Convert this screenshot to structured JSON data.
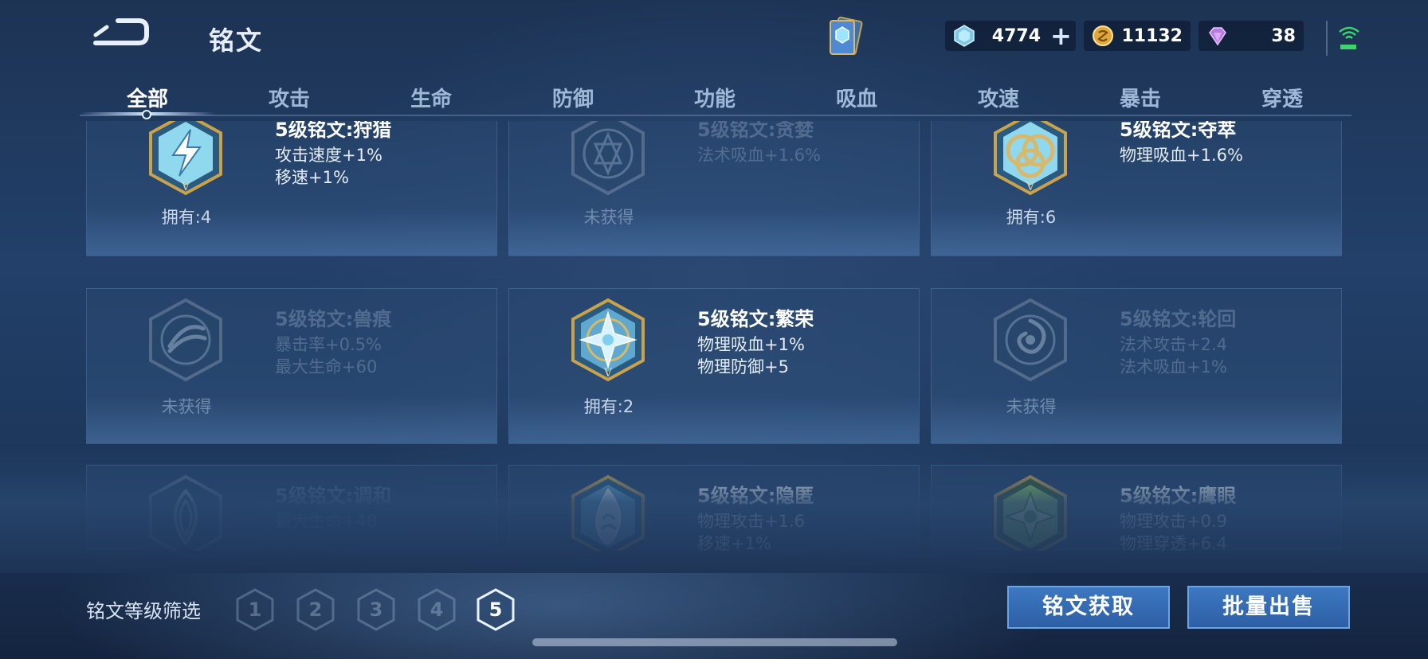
{
  "header": {
    "title": "铭文",
    "currencies": [
      {
        "icon": "crystal-icon",
        "value": "4774"
      },
      {
        "icon": "gold-coin-icon",
        "value": "11132"
      },
      {
        "icon": "diamond-icon",
        "value": "38"
      }
    ],
    "plus_label": "+"
  },
  "tabs": [
    "全部",
    "攻击",
    "生命",
    "防御",
    "功能",
    "吸血",
    "攻速",
    "暴击",
    "穿透"
  ],
  "active_tab": 0,
  "runes": [
    {
      "name": "5级铭文:狩猎",
      "stats": [
        "攻击速度+1%",
        "移速+1%"
      ],
      "owned": "拥有:4",
      "obtained": true,
      "icon": "lightning-rune-icon"
    },
    {
      "name": "5级铭文:贪婪",
      "stats": [
        "法术吸血+1.6%"
      ],
      "owned": "未获得",
      "obtained": false,
      "icon": "star-rune-icon"
    },
    {
      "name": "5级铭文:夺萃",
      "stats": [
        "物理吸血+1.6%"
      ],
      "owned": "拥有:6",
      "obtained": true,
      "icon": "knot-rune-icon"
    },
    {
      "name": "5级铭文:兽痕",
      "stats": [
        "暴击率+0.5%",
        "最大生命+60"
      ],
      "owned": "未获得",
      "obtained": false,
      "icon": "claw-rune-icon"
    },
    {
      "name": "5级铭文:繁荣",
      "stats": [
        "物理吸血+1%",
        "物理防御+5"
      ],
      "owned": "拥有:2",
      "obtained": true,
      "icon": "compass-rune-icon"
    },
    {
      "name": "5级铭文:轮回",
      "stats": [
        "法术攻击+2.4",
        "法术吸血+1%"
      ],
      "owned": "未获得",
      "obtained": false,
      "icon": "swirl-rune-icon"
    },
    {
      "name": "5级铭文:调和",
      "stats": [
        "最大生命+40"
      ],
      "owned": "",
      "obtained": false,
      "icon": "leaf-rune-icon"
    },
    {
      "name": "5级铭文:隐匿",
      "stats": [
        "物理攻击+1.6",
        "移速+1%"
      ],
      "owned": "",
      "obtained": true,
      "icon": "flame-rune-icon"
    },
    {
      "name": "5级铭文:鹰眼",
      "stats": [
        "物理攻击+0.9",
        "物理穿透+6.4"
      ],
      "owned": "",
      "obtained": true,
      "icon": "green-star-rune-icon"
    }
  ],
  "filter": {
    "label": "铭文等级筛选",
    "levels": [
      "1",
      "2",
      "3",
      "4",
      "5"
    ],
    "active_level": "5"
  },
  "buttons": {
    "obtain": "铭文获取",
    "bulk_sell": "批量出售"
  },
  "colors": {
    "background": "#1f3a60",
    "button": "#3572b8",
    "rune_gold": "#c9a24a",
    "rune_cyan": "#8fe0f0",
    "rune_green": "#8fd24a"
  }
}
